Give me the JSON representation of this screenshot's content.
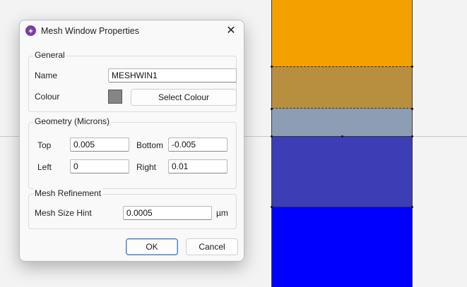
{
  "dialog": {
    "title": "Mesh Window Properties",
    "icon": "app-logo-icon",
    "close_icon": "close-icon"
  },
  "general": {
    "legend": "General",
    "name_label": "Name",
    "name_value": "MESHWIN1",
    "colour_label": "Colour",
    "colour_swatch": "#858585",
    "select_colour_label": "Select Colour"
  },
  "geometry": {
    "legend": "Geometry (Microns)",
    "top_label": "Top",
    "top_value": "0.005",
    "bottom_label": "Bottom",
    "bottom_value": "-0.005",
    "left_label": "Left",
    "left_value": "0",
    "right_label": "Right",
    "right_value": "0.01"
  },
  "refinement": {
    "legend": "Mesh Refinement",
    "hint_label": "Mesh Size Hint",
    "hint_value": "0.0005",
    "unit": "µm"
  },
  "buttons": {
    "ok": "OK",
    "cancel": "Cancel"
  },
  "layers": {
    "colors": [
      "#f4a100",
      "#b88f3e",
      "#8d9db3",
      "#3d3db5",
      "#0000fe"
    ]
  }
}
